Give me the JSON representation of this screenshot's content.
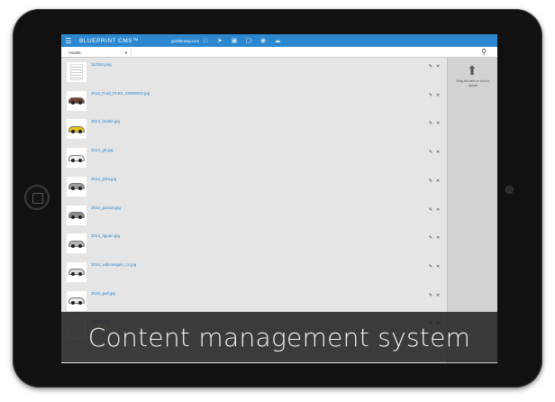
{
  "app": {
    "brand": "BLUEPRINT CMS™",
    "site": "go2fairway.com"
  },
  "toolbar_icons": [
    "menu-icon",
    "document-icon",
    "tag-icon",
    "car-icon",
    "folder-icon",
    "eye-icon",
    "cloud-upload-icon"
  ],
  "subbar": {
    "section": "Assets"
  },
  "files": [
    {
      "name": "112SM.png",
      "thumb": "document",
      "color": ""
    },
    {
      "name": "2012_Ford_FLEX_32590910.jpg",
      "thumb": "car",
      "color": "#6b4030"
    },
    {
      "name": "2014_beetle.jpg",
      "thumb": "car",
      "color": "#e6c21a"
    },
    {
      "name": "2014_gti.jpg",
      "thumb": "car",
      "color": "#f0f0f0"
    },
    {
      "name": "2014_jetta.jpg",
      "thumb": "car",
      "color": "#9a9a9a"
    },
    {
      "name": "2014_passat.jpg",
      "thumb": "car",
      "color": "#8a8a8a"
    },
    {
      "name": "2014_tiguan.jpg",
      "thumb": "car",
      "color": "#b0b4b8"
    },
    {
      "name": "2014_volkswagen_cc.jpg",
      "thumb": "car",
      "color": "#d8d8d8"
    },
    {
      "name": "2015_golf.jpg",
      "thumb": "car",
      "color": "#e8e8e8"
    },
    {
      "name": "24RM.png",
      "thumb": "document",
      "color": ""
    }
  ],
  "actions": {
    "edit": "✎",
    "delete": "✕"
  },
  "upload": {
    "text": "Drag file here or click to upload"
  },
  "caption": "Content management system"
}
